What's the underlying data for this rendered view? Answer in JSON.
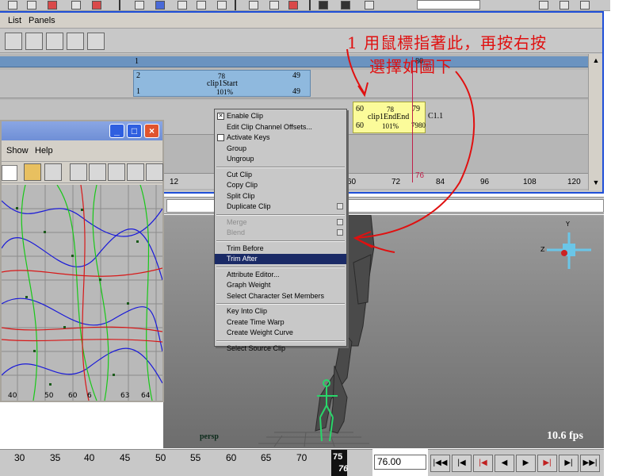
{
  "trax": {
    "menus": [
      "List",
      "Panels"
    ],
    "track_header_number": "1",
    "clip_start": {
      "start": "2",
      "name_label": "78",
      "name": "clip1Start",
      "end": "49",
      "row2_start": "1",
      "percent": "101%",
      "row2_end": "49"
    },
    "clip_end": {
      "start": "60",
      "name_label": "78",
      "name": "clip1EndEnd",
      "end": "79",
      "row2_start": "60",
      "percent": "101%",
      "row2_end": "7980",
      "tag": "C1.1"
    },
    "header_number_right": "80",
    "ruler_numbers": [
      "12",
      "60",
      "72",
      "84",
      "96",
      "108",
      "120"
    ],
    "current_time_label": "76"
  },
  "graph_editor": {
    "menus": [
      "Show",
      "Help"
    ],
    "axis_numbers": [
      "40",
      "50",
      "60",
      "6",
      "63",
      "64"
    ]
  },
  "viewport": {
    "camera_label": "persp",
    "fps": "10.6 fps",
    "axis_labels": {
      "y": "Y",
      "z": "Z"
    }
  },
  "context_menu": {
    "groups": [
      [
        {
          "label": "Enable Clip",
          "check": true
        },
        {
          "label": "Edit Clip Channel Offsets..."
        },
        {
          "label": "Activate Keys",
          "checkbox": true
        },
        {
          "label": "Group"
        },
        {
          "label": "Ungroup"
        }
      ],
      [
        {
          "label": "Cut Clip"
        },
        {
          "label": "Copy Clip"
        },
        {
          "label": "Split Clip"
        },
        {
          "label": "Duplicate Clip",
          "option": true
        }
      ],
      [
        {
          "label": "Merge",
          "disabled": true,
          "option": true
        },
        {
          "label": "Blend",
          "disabled": true,
          "option": true
        }
      ],
      [
        {
          "label": "Trim Before"
        },
        {
          "label": "Trim After",
          "highlighted": true
        }
      ],
      [
        {
          "label": "Attribute Editor..."
        },
        {
          "label": "Graph Weight"
        },
        {
          "label": "Select Character Set Members"
        }
      ],
      [
        {
          "label": "Key Into Clip"
        },
        {
          "label": "Create Time Warp"
        },
        {
          "label": "Create Weight Curve"
        }
      ],
      [
        {
          "label": "Select Source Clip"
        }
      ]
    ]
  },
  "annotation": {
    "line1": "1 用鼠標指著此，再按右按",
    "line2": "選擇如圖下"
  },
  "time_slider": {
    "numbers": [
      "30",
      "35",
      "40",
      "45",
      "50",
      "55",
      "60",
      "65",
      "70"
    ],
    "current_top": "75",
    "current_bottom": "76",
    "current_frame": "76.00"
  },
  "playback": {
    "buttons": [
      "go-to-start",
      "step-back-key",
      "step-back-frame",
      "play-backwards",
      "play-forwards",
      "step-forward-frame",
      "step-forward-key",
      "go-to-end"
    ]
  },
  "colors": {
    "panel_border": "#1f4fd8",
    "annotation": "#e01010",
    "clip_blue": "#8fb9de",
    "clip_yellow": "#fbfb9a",
    "menu_highlight": "#1a2a66"
  }
}
